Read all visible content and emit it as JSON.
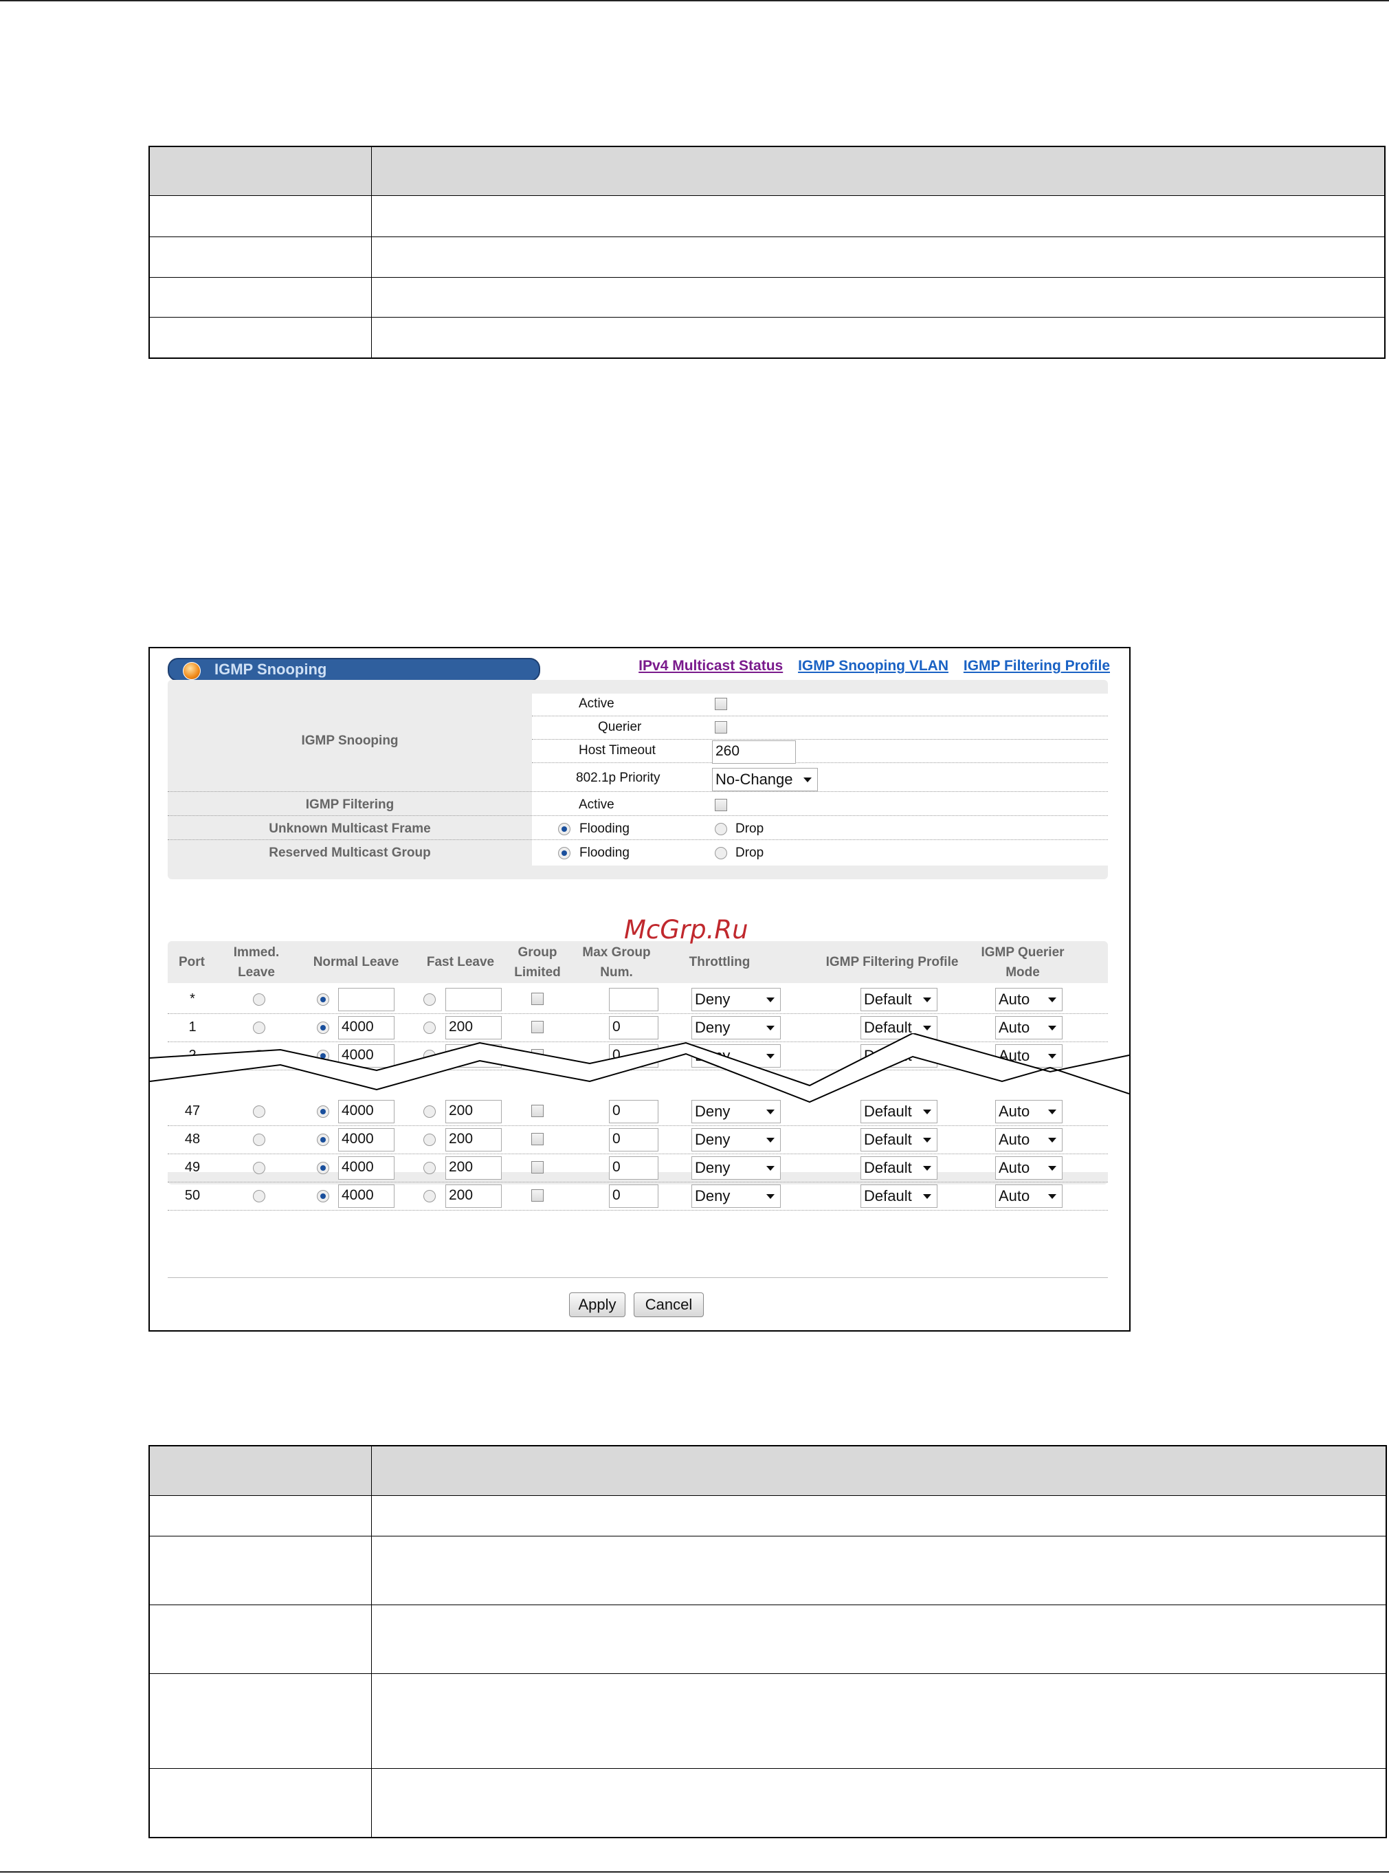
{
  "screenshot": {
    "title": "IGMP Snooping",
    "links": [
      {
        "label": "IPv4 Multicast Status"
      },
      {
        "label": "IGMP Snooping VLAN"
      },
      {
        "label": "IGMP Filtering Profile"
      }
    ],
    "settings": {
      "igmp_snooping_label": "IGMP Snooping",
      "active_label": "Active",
      "querier_label": "Querier",
      "host_timeout_label": "Host Timeout",
      "host_timeout_value": "260",
      "priority_label": "802.1p Priority",
      "priority_value": "No-Change",
      "igmp_filtering_label": "IGMP Filtering",
      "igmp_filtering_active_label": "Active",
      "unknown_multicast_label": "Unknown Multicast Frame",
      "reserved_multicast_label": "Reserved Multicast Group",
      "flooding_label": "Flooding",
      "drop_label": "Drop"
    },
    "port_table": {
      "headers": {
        "port": "Port",
        "immed_leave": "Immed. Leave",
        "normal_leave": "Normal Leave",
        "fast_leave": "Fast Leave",
        "group_limited": "Group Limited",
        "max_group_num": "Max Group Num.",
        "throttling": "Throttling",
        "filtering_profile": "IGMP Filtering Profile",
        "querier_mode": "IGMP Querier Mode"
      },
      "rows": [
        {
          "port": "*",
          "normal_leave": "",
          "fast_leave": "",
          "max_group": "",
          "throttling": "Deny",
          "profile": "Default",
          "mode": "Auto"
        },
        {
          "port": "1",
          "normal_leave": "4000",
          "fast_leave": "200",
          "max_group": "0",
          "throttling": "Deny",
          "profile": "Default",
          "mode": "Auto"
        },
        {
          "port": "2",
          "normal_leave": "4000",
          "fast_leave": "200",
          "max_group": "0",
          "throttling": "Deny",
          "profile": "Default",
          "mode": "Auto"
        },
        {
          "port": "47",
          "normal_leave": "4000",
          "fast_leave": "200",
          "max_group": "0",
          "throttling": "Deny",
          "profile": "Default",
          "mode": "Auto"
        },
        {
          "port": "48",
          "normal_leave": "4000",
          "fast_leave": "200",
          "max_group": "0",
          "throttling": "Deny",
          "profile": "Default",
          "mode": "Auto"
        },
        {
          "port": "49",
          "normal_leave": "4000",
          "fast_leave": "200",
          "max_group": "0",
          "throttling": "Deny",
          "profile": "Default",
          "mode": "Auto"
        },
        {
          "port": "50",
          "normal_leave": "4000",
          "fast_leave": "200",
          "max_group": "0",
          "throttling": "Deny",
          "profile": "Default",
          "mode": "Auto"
        }
      ]
    },
    "buttons": {
      "apply": "Apply",
      "cancel": "Cancel"
    }
  },
  "watermark": "McGrp.Ru"
}
